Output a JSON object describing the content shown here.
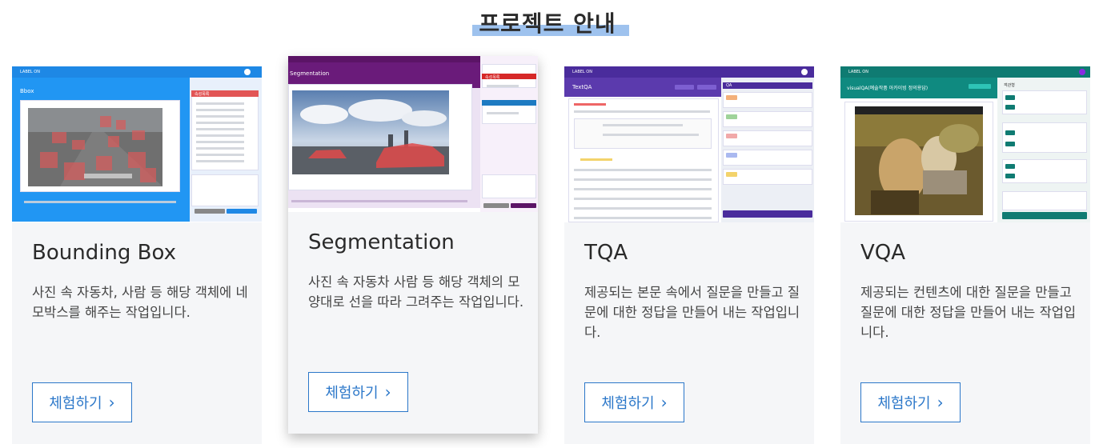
{
  "page": {
    "title": "프로젝트 안내"
  },
  "cards": [
    {
      "title": "Bounding Box",
      "description": "사진 속 자동차, 사람 등 해당 객체에 네모박스를 해주는 작업입니다.",
      "button_label": "체험하기",
      "thumb": {
        "header": "Bbox",
        "logo": "LABEL ON",
        "panel_title": "속성목록"
      }
    },
    {
      "title": "Segmentation",
      "description": "사진 속 자동차 사람 등 해당 객체의 모양대로 선을 따라 그려주는 작업입니다.",
      "button_label": "체험하기",
      "thumb": {
        "header": "Segmentation",
        "panel_title": "속성목록"
      }
    },
    {
      "title": "TQA",
      "description": "제공되는 본문 속에서 질문을 만들고 질문에 대한 정답을 만들어 내는 작업입니다.",
      "button_label": "체험하기",
      "thumb": {
        "header": "TextQA",
        "logo": "LABEL ON",
        "panel_title": "QA"
      }
    },
    {
      "title": "VQA",
      "description": "제공되는 컨텐츠에 대한 질문을 만들고 질문에 대한 정답을 만들어 내는 작업입니다.",
      "button_label": "체험하기",
      "thumb": {
        "header": "visualQA(예술작품 아카이빙 정의용답)",
        "logo": "LABEL ON",
        "panel_title": "객관형"
      }
    }
  ],
  "colors": {
    "accent": "#2b77c9",
    "title_highlight": "#9ec2ee",
    "bbox_header": "#1e88e5",
    "seg_header": "#5b1466",
    "tqa_header": "#4a2c9c",
    "vqa_header": "#0f8a80"
  },
  "icons": {
    "button_chevron": "chevron-right-icon"
  }
}
